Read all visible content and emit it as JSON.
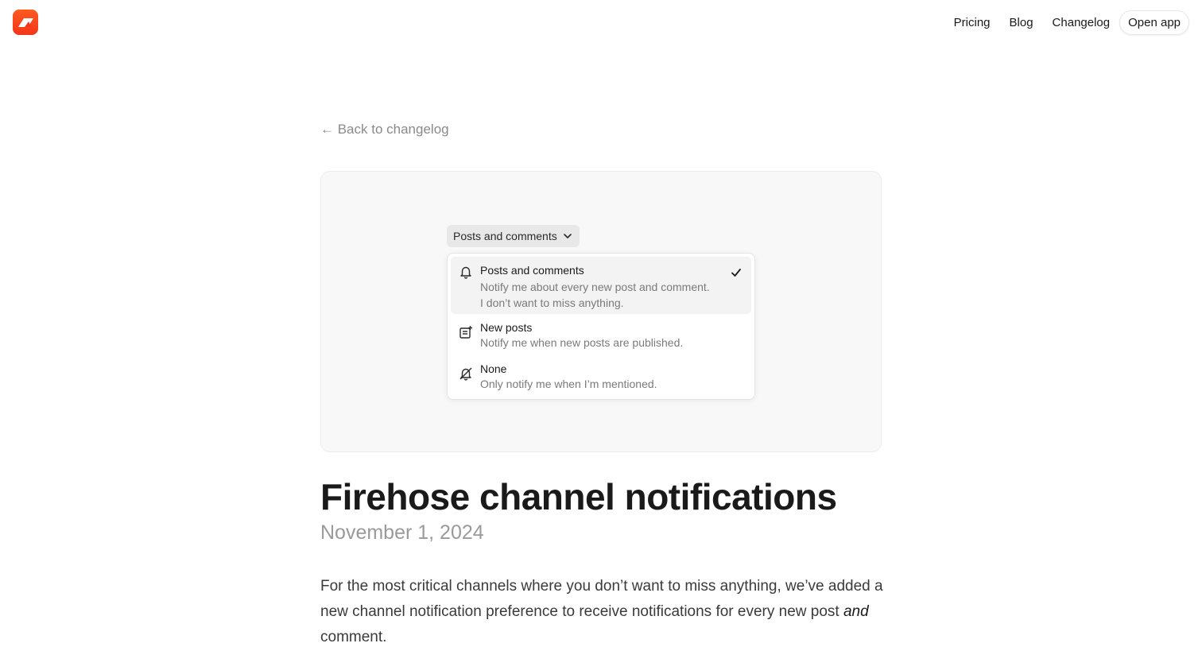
{
  "header": {
    "logo_name": "logo-icon",
    "nav": [
      {
        "label": "Pricing"
      },
      {
        "label": "Blog"
      },
      {
        "label": "Changelog"
      }
    ],
    "open_app_label": "Open app"
  },
  "back_link": "← Back to changelog",
  "hero": {
    "trigger_label": "Posts and comments",
    "options": [
      {
        "title": "Posts and comments",
        "desc_line1": "Notify me about every new post and comment.",
        "desc_line2": "I don’t want to miss anything.",
        "icon": "bell-icon",
        "selected": true
      },
      {
        "title": "New posts",
        "desc_line1": "Notify me when new posts are published.",
        "icon": "new-post-icon",
        "selected": false
      },
      {
        "title": "None",
        "desc_line1": "Only notify me when I’m mentioned.",
        "icon": "bell-off-icon",
        "selected": false
      }
    ]
  },
  "article": {
    "title": "Firehose channel notifications",
    "date": "November 1, 2024",
    "body_part1": "For the most critical channels where you don’t want to miss anything, we’ve added a new channel notification preference to receive notifications for every new post ",
    "body_italic": "and",
    "body_part2": " comment."
  },
  "colors": {
    "brand": "#f3361a",
    "muted_text": "#8a8a8a",
    "hero_bg": "#f8f8f8"
  }
}
